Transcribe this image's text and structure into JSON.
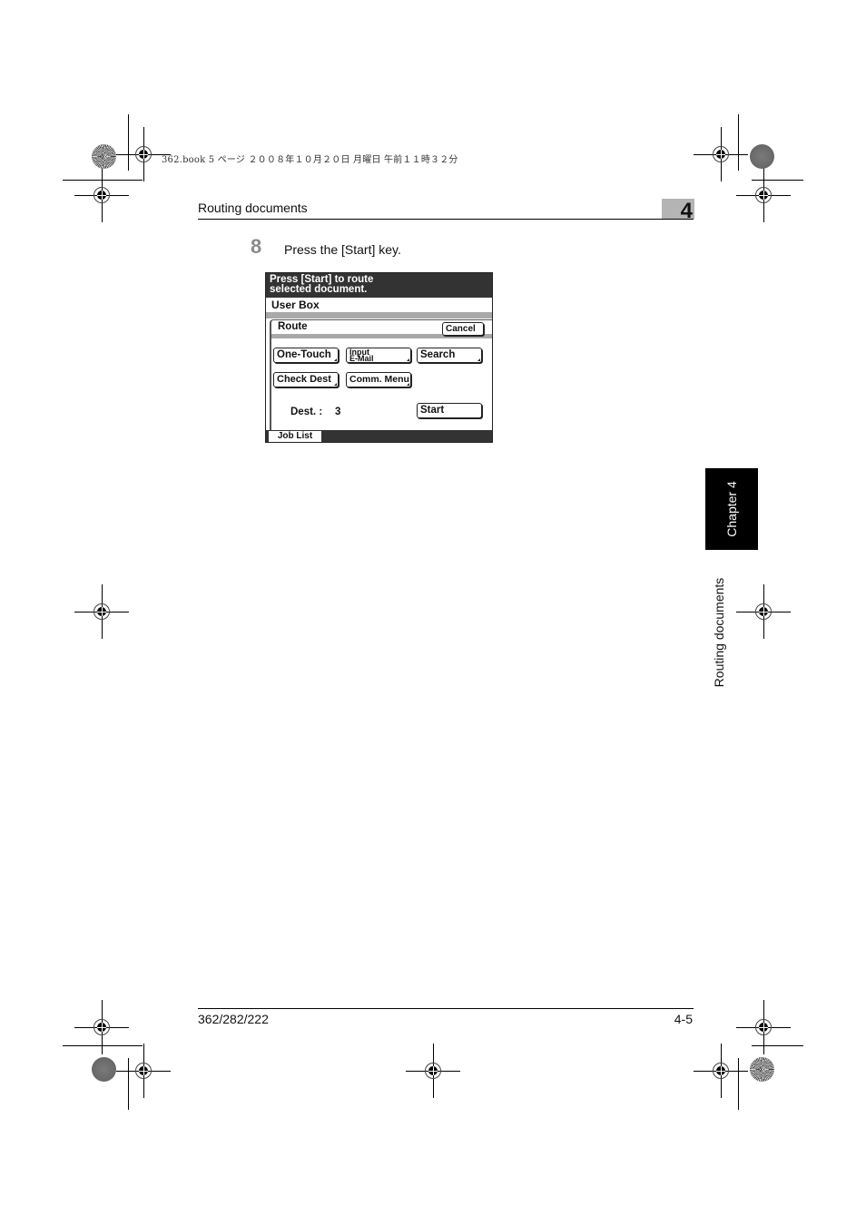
{
  "print_header": {
    "text": "362.book  5 ページ  ２００８年１０月２０日  月曜日  午前１１時３２分"
  },
  "running_header": {
    "title": "Routing documents",
    "chapter_number": "4"
  },
  "step": {
    "number": "8",
    "instruction": "Press the [Start] key."
  },
  "screen": {
    "message_line1": "Press [Start] to route",
    "message_line2": "selected document.",
    "breadcrumb": "User Box",
    "section_title": "Route",
    "buttons": {
      "cancel": "Cancel",
      "one_touch": "One-Touch",
      "input_email_line1": "Input",
      "input_email_line2": "E-Mail",
      "search": "Search",
      "check_dest": "Check Dest",
      "comm_menu": "Comm. Menu",
      "start": "Start"
    },
    "dest_label": "Dest.  :",
    "dest_value": "3",
    "footer_tab": "Job List"
  },
  "side_tab": {
    "chapter": "Chapter 4",
    "title": "Routing documents"
  },
  "footer": {
    "model": "362/282/222",
    "page": "4-5"
  },
  "colors": {
    "panel_dark": "#333333",
    "panel_grey_bar": "#a9a9a9",
    "chapter_box": "#b4b4b4",
    "step_number": "#8a8a8a",
    "side_tab_bg": "#000000"
  }
}
